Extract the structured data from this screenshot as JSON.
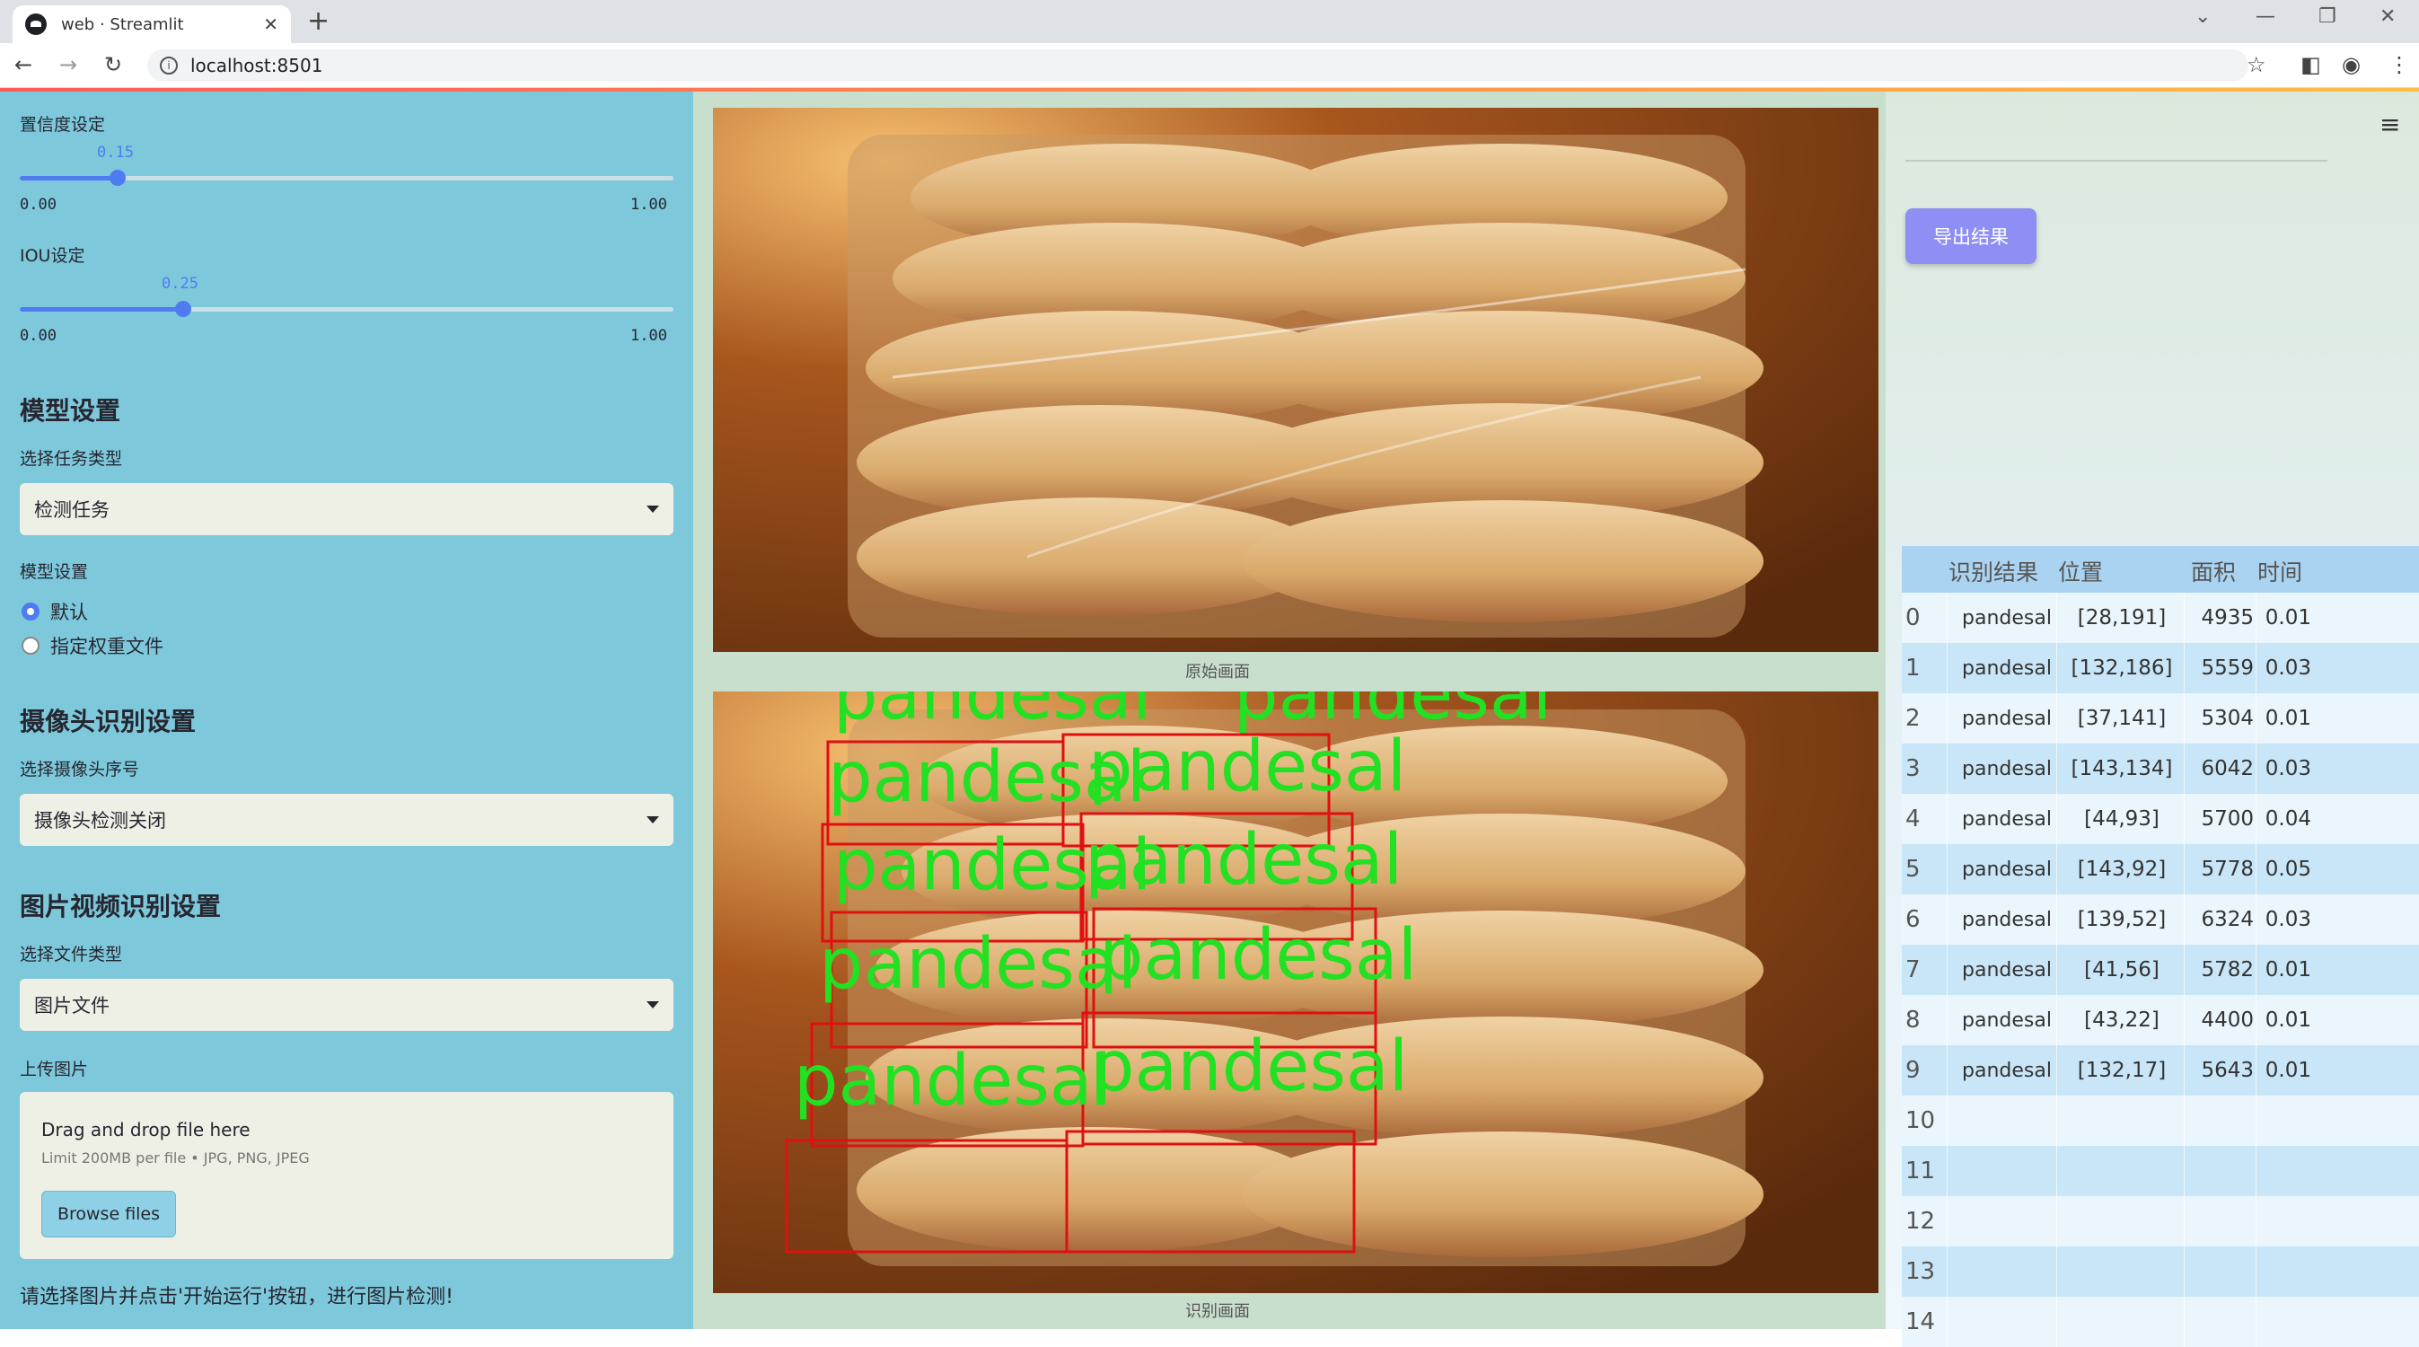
{
  "browser": {
    "tab_title": "web · Streamlit",
    "tab_close": "✕",
    "new_tab": "+",
    "url": "localhost:8501"
  },
  "sidebar": {
    "confidence": {
      "label": "置信度设定",
      "value": "0.15",
      "min": "0.00",
      "max": "1.00",
      "fraction": 0.15
    },
    "iou": {
      "label": "IOU设定",
      "value": "0.25",
      "min": "0.00",
      "max": "1.00",
      "fraction": 0.25
    },
    "model_heading": "模型设置",
    "task_type_label": "选择任务类型",
    "task_type_value": "检测任务",
    "model_setting_label": "模型设置",
    "model_options": [
      "默认",
      "指定权重文件"
    ],
    "model_selected": "默认",
    "camera_heading": "摄像头识别设置",
    "camera_label": "选择摄像头序号",
    "camera_value": "摄像头检测关闭",
    "media_heading": "图片视频识别设置",
    "file_type_label": "选择文件类型",
    "file_type_value": "图片文件",
    "upload_label": "上传图片",
    "upload_main": "Drag and drop file here",
    "upload_sub": "Limit 200MB per file • JPG, PNG, JPEG",
    "browse_label": "Browse files",
    "hint": "请选择图片并点击'开始运行'按钮，进行图片检测!"
  },
  "main": {
    "original_caption": "原始画面",
    "result_caption": "识别画面",
    "export_label": "导出结果",
    "detection_label": "pandesal",
    "table": {
      "headers": [
        "",
        "识别结果",
        "位置",
        "面积",
        "时间"
      ],
      "rows": [
        [
          "0",
          "pandesal",
          "[28,191]",
          "4935",
          "0.01"
        ],
        [
          "1",
          "pandesal",
          "[132,186]",
          "5559",
          "0.03"
        ],
        [
          "2",
          "pandesal",
          "[37,141]",
          "5304",
          "0.01"
        ],
        [
          "3",
          "pandesal",
          "[143,134]",
          "6042",
          "0.03"
        ],
        [
          "4",
          "pandesal",
          "[44,93]",
          "5700",
          "0.04"
        ],
        [
          "5",
          "pandesal",
          "[143,92]",
          "5778",
          "0.05"
        ],
        [
          "6",
          "pandesal",
          "[139,52]",
          "6324",
          "0.03"
        ],
        [
          "7",
          "pandesal",
          "[41,56]",
          "5782",
          "0.01"
        ],
        [
          "8",
          "pandesal",
          "[43,22]",
          "4400",
          "0.01"
        ],
        [
          "9",
          "pandesal",
          "[132,17]",
          "5643",
          "0.01"
        ],
        [
          "10",
          "",
          "",
          "",
          ""
        ],
        [
          "11",
          "",
          "",
          "",
          ""
        ],
        [
          "12",
          "",
          "",
          "",
          ""
        ],
        [
          "13",
          "",
          "",
          "",
          ""
        ],
        [
          "14",
          "",
          "",
          "",
          ""
        ]
      ]
    }
  },
  "colors": {
    "sidebar_bg": "#7ec8dc",
    "main_bg": "#c9dfcd",
    "accent": "#4e7cf0",
    "export_button": "#8e8ef5",
    "detection_box": "#e01010",
    "detection_text": "#22e022"
  }
}
